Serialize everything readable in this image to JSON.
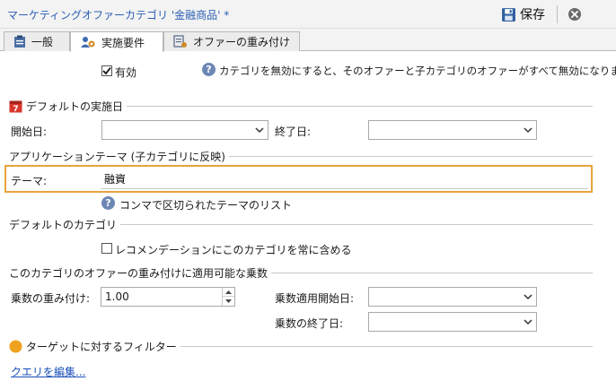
{
  "window": {
    "title": "マーケティングオファーカテゴリ '金融商品' *",
    "save_label": "保存"
  },
  "tabs": [
    {
      "label": "一般"
    },
    {
      "label": "実施要件"
    },
    {
      "label": "オファーの重み付け"
    }
  ],
  "enabled": {
    "label": "有効",
    "checked": true,
    "info": "カテゴリを無効にすると、そのオファーと子カテゴリのオファーがすべて無効になります。"
  },
  "default_dates": {
    "section_title": "デフォルトの実施日",
    "start_label": "開始日:",
    "end_label": "終了日:"
  },
  "app_theme": {
    "section_title": "アプリケーションテーマ (子カテゴリに反映)",
    "theme_label": "テーマ:",
    "theme_value": "融資",
    "hint": "コンマで区切られたテーマのリスト"
  },
  "default_category": {
    "section_title": "デフォルトのカテゴリ",
    "checkbox_label": "レコメンデーションにこのカテゴリを常に含める",
    "checked": false
  },
  "weight_multiplier": {
    "section_title": "このカテゴリのオファーの重み付けに適用可能な乗数",
    "weight_label": "乗数の重み付け:",
    "weight_value": "1.00",
    "start_label": "乗数適用開始日:",
    "end_label": "乗数の終了日:"
  },
  "target_filter": {
    "section_title": "ターゲットに対するフィルター",
    "edit_query_link": "クエリを編集..."
  },
  "colors": {
    "accent_orange": "#e8a33d",
    "title_blue": "#2b5fb4",
    "link_blue": "#1a4fb8"
  }
}
